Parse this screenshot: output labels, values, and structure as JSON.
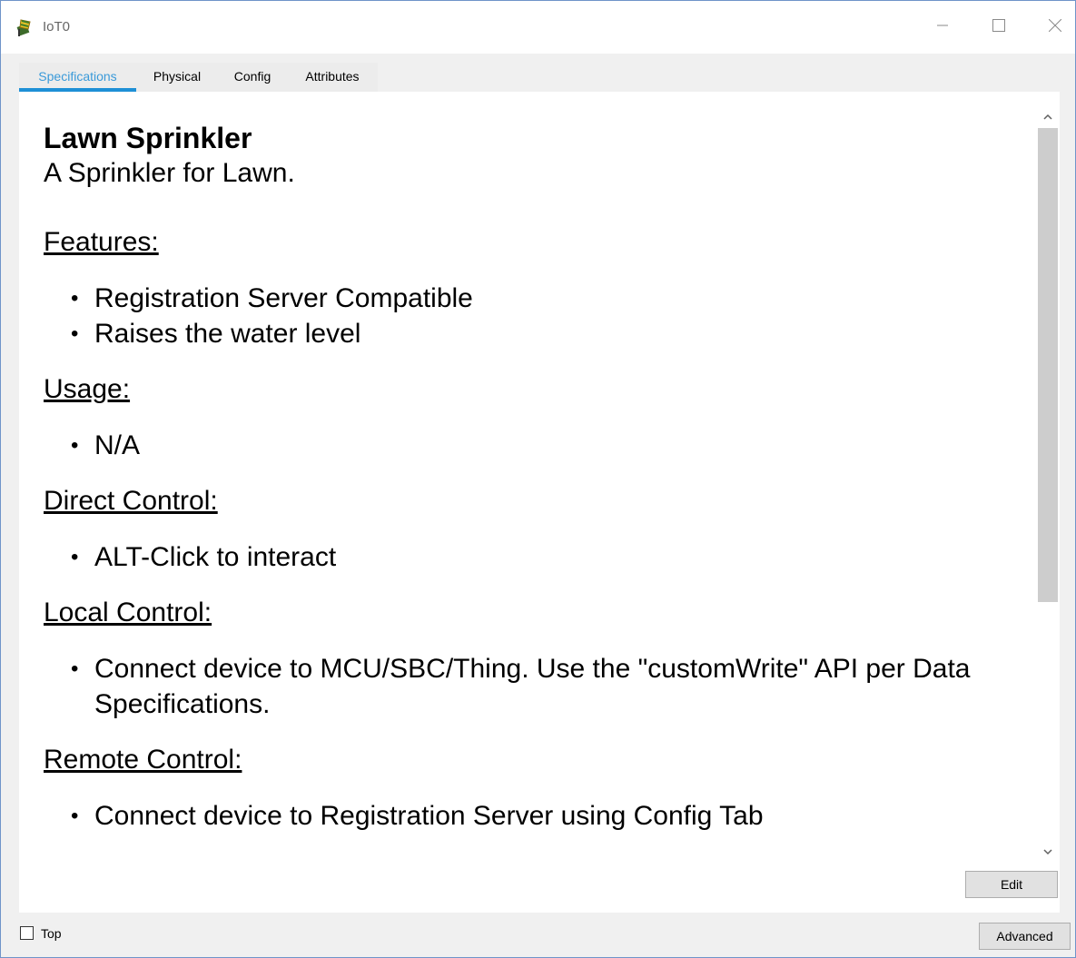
{
  "window": {
    "title": "IoT0",
    "icon": "iot-sprinkler-icon",
    "controls": {
      "minimize": "minimize-icon",
      "maximize": "maximize-icon",
      "close": "close-icon"
    }
  },
  "tabs": [
    {
      "label": "Specifications",
      "active": true
    },
    {
      "label": "Physical",
      "active": false
    },
    {
      "label": "Config",
      "active": false
    },
    {
      "label": "Attributes",
      "active": false
    }
  ],
  "spec": {
    "name": "Lawn Sprinkler",
    "description": "A Sprinkler for Lawn.",
    "sections": [
      {
        "heading": "Features:",
        "items": [
          "Registration Server Compatible",
          "Raises the water level"
        ]
      },
      {
        "heading": "Usage:",
        "items": [
          "N/A"
        ]
      },
      {
        "heading": "Direct Control:",
        "items": [
          "ALT-Click to interact"
        ]
      },
      {
        "heading": "Local Control:",
        "items": [
          "Connect device to MCU/SBC/Thing. Use the \"customWrite\" API per Data Specifications."
        ]
      },
      {
        "heading": "Remote Control:",
        "items": [
          "Connect device to Registration Server using Config Tab"
        ]
      }
    ]
  },
  "buttons": {
    "edit": "Edit",
    "advanced": "Advanced"
  },
  "footer": {
    "top_label": "Top",
    "top_checked": false
  },
  "colors": {
    "active_tab_text": "#3a9ad9",
    "active_tab_underline": "#1e90d6",
    "window_border": "#6f94c9"
  }
}
